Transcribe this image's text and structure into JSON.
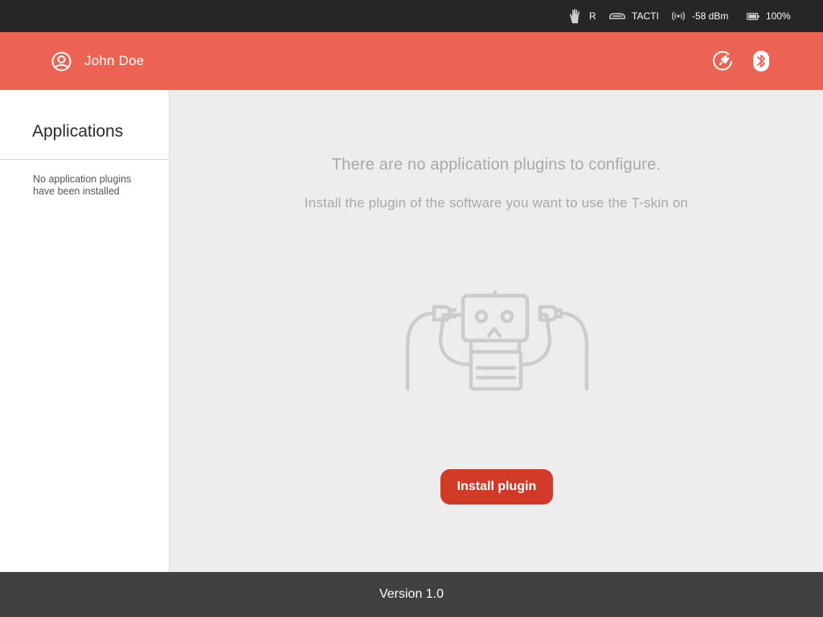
{
  "status_bar": {
    "hand": "R",
    "device": "TACTI",
    "signal": "-58 dBm",
    "battery": "100%",
    "icons": [
      "hand-icon",
      "device-icon",
      "signal-icon",
      "battery-icon"
    ]
  },
  "header": {
    "user_name": "John Doe",
    "icons": [
      "user-icon",
      "power-plug-icon",
      "bluetooth-icon"
    ],
    "accent_color": "#ec6353"
  },
  "sidebar": {
    "title": "Applications",
    "empty_text": "No application plugins have been installed"
  },
  "main": {
    "message": "There are no application plugins to configure.",
    "hint": "Install the plugin of the software you want to use the T-skin on",
    "illustration": "robot-plug-icon",
    "install_button": "Install plugin",
    "button_color": "#d23a28"
  },
  "footer": {
    "version": "Version 1.0"
  }
}
